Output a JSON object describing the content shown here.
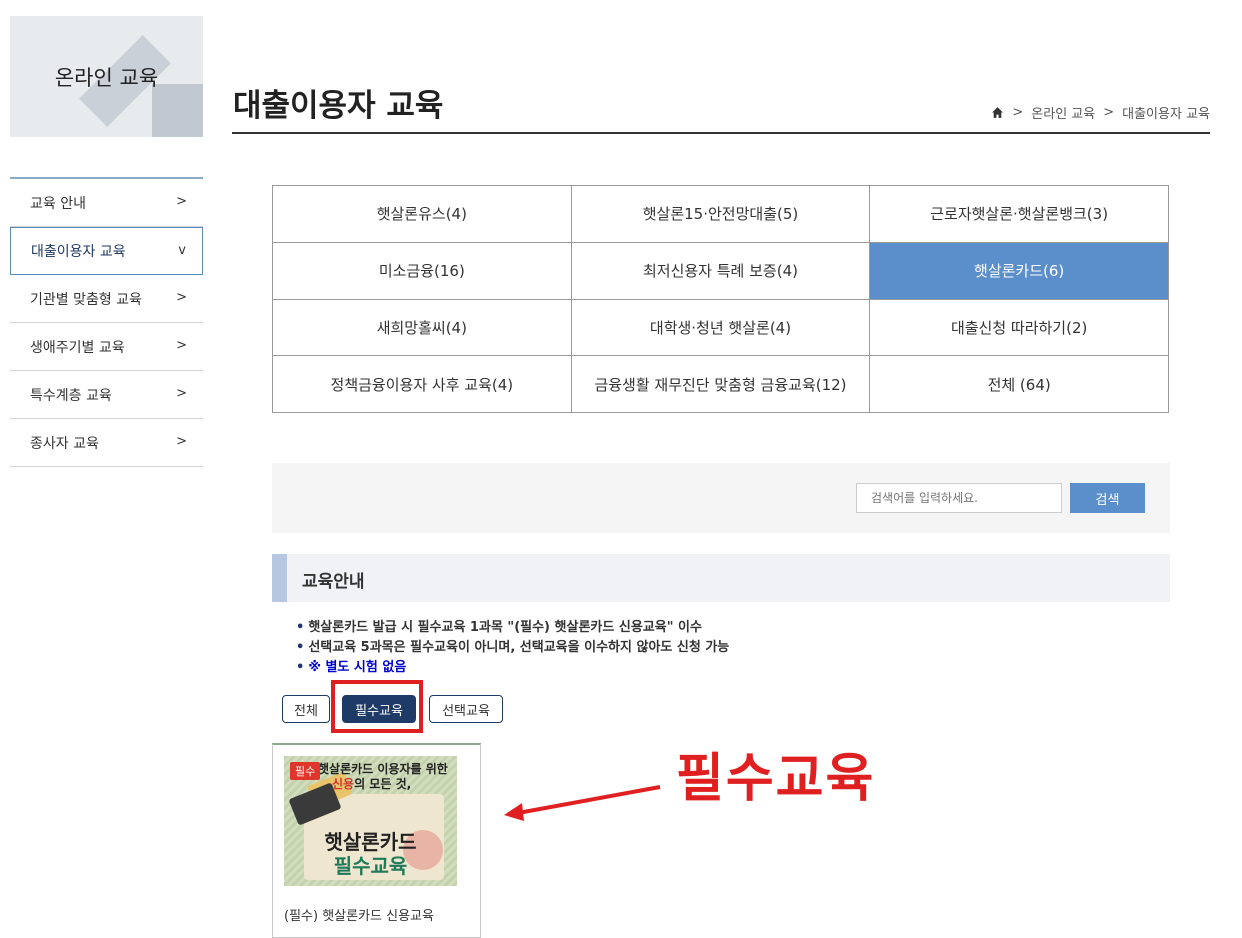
{
  "sidebar": {
    "banner_title": "온라인 교육",
    "items": [
      {
        "label": "교육 안내",
        "chevron": ">"
      },
      {
        "label": "대출이용자 교육",
        "chevron": "v"
      },
      {
        "label": "기관별 맞춤형 교육",
        "chevron": ">"
      },
      {
        "label": "생애주기별 교육",
        "chevron": ">"
      },
      {
        "label": "특수계층 교육",
        "chevron": ">"
      },
      {
        "label": "종사자 교육",
        "chevron": ">"
      }
    ],
    "active_index": 1
  },
  "header": {
    "title": "대출이용자 교육",
    "breadcrumb": [
      ">",
      "온라인 교육",
      ">",
      "대출이용자 교육"
    ]
  },
  "categories": [
    "햇살론유스(4)",
    "햇살론15·안전망대출(5)",
    "근로자햇살론·햇살론뱅크(3)",
    "미소금융(16)",
    "최저신용자 특례 보증(4)",
    "햇살론카드(6)",
    "새희망홀씨(4)",
    "대학생·청년 햇살론(4)",
    "대출신청 따라하기(2)",
    "정책금융이용자 사후 교육(4)",
    "금융생활 재무진단 맞춤형 금융교육(12)",
    "전체 (64)"
  ],
  "selected_category": "햇살론카드(6)",
  "search": {
    "placeholder": "검색어를 입력하세요.",
    "button_label": "검색"
  },
  "guide": {
    "heading": "교육안내",
    "bullets": [
      "햇살론카드 발급 시 필수교육 1과목 \"(필수) 햇살론카드 신용교육\" 이수",
      "선택교육 5과목은 필수교육이 아니며, 선택교육을 이수하지 않아도 신청 가능",
      "※ 별도 시험 없음"
    ]
  },
  "filters": [
    "전체",
    "필수교육",
    "선택교육"
  ],
  "active_filter": "필수교육",
  "course_card": {
    "badge": "필수",
    "thumb_line1": "햇살론카드 이용자를 위한",
    "thumb_line2_red": "신용",
    "thumb_line2_rest": "의 모든 것,",
    "thumb_title1": "햇살론카드",
    "thumb_title2": "필수교육",
    "caption": "(필수) 햇살론카드 신용교육"
  },
  "annotation": "필수교육",
  "colors": {
    "accent_blue": "#5b8fcb",
    "navy": "#1e3a66",
    "highlight_red": "#e02020"
  }
}
